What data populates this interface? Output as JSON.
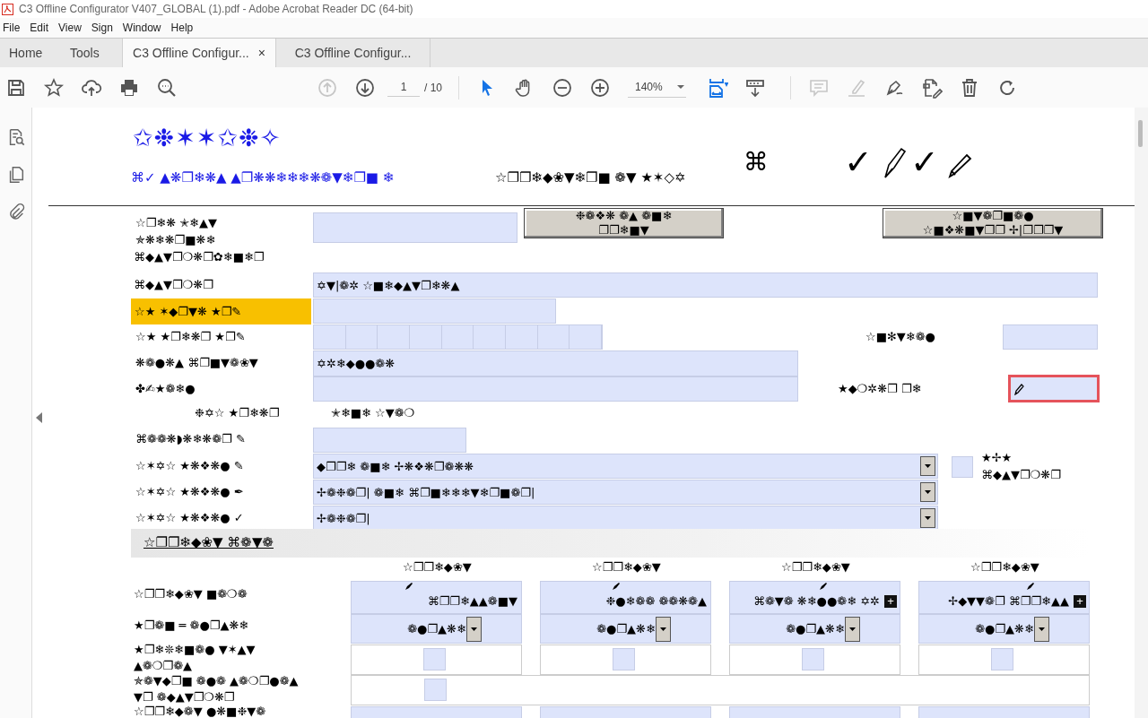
{
  "window": {
    "title": "C3 Offline Configurator V407_GLOBAL (1).pdf - Adobe Acrobat Reader DC (64-bit)"
  },
  "menu": [
    "File",
    "Edit",
    "View",
    "Sign",
    "Window",
    "Help"
  ],
  "tabs": [
    {
      "label": "Home",
      "selected": false
    },
    {
      "label": "Tools",
      "selected": false
    },
    {
      "label": "C3 Offline Configur...",
      "selected": true,
      "close": "×"
    },
    {
      "label": "C3 Offline Configur...",
      "selected": false
    }
  ],
  "toolbar": {
    "page": "1",
    "page_total": "/ 10",
    "zoom": "140%",
    "tools": [
      {
        "kind": "save",
        "disabled": false,
        "selected": false
      },
      {
        "kind": "star",
        "disabled": false,
        "selected": false
      },
      {
        "kind": "upload",
        "disabled": false,
        "selected": false
      },
      {
        "kind": "print",
        "disabled": false,
        "selected": false
      },
      {
        "kind": "search",
        "disabled": false,
        "selected": false
      },
      {
        "kind": "prev",
        "disabled": true,
        "selected": false
      },
      {
        "kind": "next",
        "disabled": false,
        "selected": false
      },
      {
        "kind": "select",
        "disabled": false,
        "selected": true
      },
      {
        "kind": "hand",
        "disabled": false,
        "selected": false
      },
      {
        "kind": "zoomout",
        "disabled": false,
        "selected": false
      },
      {
        "kind": "zoomin",
        "disabled": false,
        "selected": false
      },
      {
        "kind": "fit",
        "disabled": false,
        "selected": true
      },
      {
        "kind": "scroll",
        "disabled": false,
        "selected": false
      },
      {
        "kind": "comment",
        "disabled": true,
        "selected": false
      },
      {
        "kind": "highlight",
        "disabled": true,
        "selected": false
      },
      {
        "kind": "sign",
        "disabled": false,
        "selected": false
      },
      {
        "kind": "edit",
        "disabled": false,
        "selected": false
      },
      {
        "kind": "delete",
        "disabled": false,
        "selected": false
      },
      {
        "kind": "rotate",
        "disabled": false,
        "selected": false
      }
    ]
  },
  "document": {
    "heading": "✩❉✶✶✩❉✧",
    "subheading": "⌘✓ ▲❋❐❄❋▲ ▲❐❋❋❄❄❄❋❁▼❄❐■ ❄",
    "caption": "☆❐❐❄◆❀▼❄❐■ ❁▼ ★✶◇✡",
    "symbol": "⌘",
    "marks": [
      "✓",
      "✓"
    ],
    "form": [
      {
        "kind": "label",
        "text": "☆❐❄❋ ✭❄▲▼",
        "highlighted": false
      },
      {
        "kind": "label",
        "text": "✯❋❄❋❐■❋❄",
        "highlighted": false
      },
      {
        "kind": "label",
        "text": "⌘◆▲▼❐❍❋❐✿❄■❄❐",
        "highlighted": false
      },
      {
        "kind": "text",
        "focused": false
      },
      {
        "kind": "button",
        "lines": [
          "❉❁❖❋ ❁▲ ❁■❄",
          "❐❐❄■▼"
        ]
      },
      {
        "kind": "button",
        "lines": [
          "☆■▼❁❐■❁●",
          "☆■❖❋■▼❐❐ ✢|❐❐❐▼"
        ]
      },
      {
        "kind": "label",
        "text": "⌘◆▲▼❐❍❋❐",
        "highlighted": false
      },
      {
        "kind": "text",
        "value": "✡▼|❁✲ ☆■❄◆▲▼❐❄❋▲",
        "focused": false
      },
      {
        "kind": "label",
        "text": "☆★ ✶◆❐▼❋ ★❐✎",
        "highlighted": true
      },
      {
        "kind": "text",
        "focused": false
      },
      {
        "kind": "label",
        "text": "☆★ ★❐❄❋❐ ★❐✎",
        "highlighted": false
      },
      {
        "kind": "comb"
      },
      {
        "kind": "label",
        "text": "☆■✻▼❄❁●",
        "highlighted": false
      },
      {
        "kind": "text",
        "focused": false
      },
      {
        "kind": "label",
        "text": "❋❁●❋▲ ⌘❐■▼❁❀▼",
        "highlighted": false
      },
      {
        "kind": "text",
        "value": "✡✲❄◆●●❁❋",
        "focused": false
      },
      {
        "kind": "label",
        "text": "✤✍★❁❄●",
        "highlighted": false
      },
      {
        "kind": "text",
        "focused": false
      },
      {
        "kind": "label",
        "text": "★◆❍✲❋❐ ❐❄",
        "highlighted": false
      },
      {
        "kind": "text",
        "focused": true
      },
      {
        "kind": "label",
        "text": "❉✡☆ ★❐❄❋❐",
        "highlighted": false
      },
      {
        "kind": "label",
        "text": "✭❄■❄ ☆▼❁❍",
        "highlighted": false
      },
      {
        "kind": "label",
        "text": "⌘❁❁❋◗❋❄❋❁❐ ✎",
        "highlighted": false
      },
      {
        "kind": "text",
        "focused": false
      },
      {
        "kind": "label",
        "text": "☆✶✡☆ ★❋❖❋● ✎",
        "highlighted": false
      },
      {
        "kind": "dropdown",
        "value": "◆❐❐❄ ❁■❄ ✢❋❖❋❐❁❋❋"
      },
      {
        "kind": "label",
        "text": "☆✶✡☆ ★❋❖❋● ✒",
        "highlighted": false
      },
      {
        "kind": "dropdown",
        "value": "✢❁❉❁❐| ❁■❄ ⌘❐■❄❄❄▼❄❐■❁❐|"
      },
      {
        "kind": "label",
        "text": "☆✶✡☆ ★❋❖❋● ✓",
        "highlighted": false
      },
      {
        "kind": "dropdown",
        "value": "✢❁❉❁❐|"
      },
      {
        "kind": "checkbox",
        "checked": false
      },
      {
        "kind": "label",
        "text": "★✢★",
        "highlighted": false
      },
      {
        "kind": "label",
        "text": "⌘◆▲▼❐❍❋❐",
        "highlighted": false
      }
    ],
    "section": "☆❐❐❄◆❀▼ ⌘❁▼❁",
    "row_labels": [
      "☆❐❐❄◆❀▼ ■❁❍❁",
      "★❐❁■ ═ ❁●❐▲❋❄",
      "★❐❄❊❄■❁● ▼✶▲▼",
      "▲❁❍❐❁▲",
      "✯❁▼◆❐■ ❁●❁ ▲❁❍❐●❁▲",
      "▼❐ ❁◆▲▼❐❍❋❐",
      "☆❐❐❄◆❁▼ ●❋■❉▼❁"
    ],
    "products": [
      {
        "header": "☆❐❐❄◆❀▼",
        "name": "⌘❐❐❄▲▲❁■▼",
        "option": "❁●❐▲❋❄",
        "checked": false
      },
      {
        "header": "☆❐❐❄◆❀▼",
        "name": "❉●❄❁❁ ❁❁❋❁▲",
        "option": "❁●❐▲❋❄",
        "checked": false
      },
      {
        "header": "☆❐❐❄◆❀▼",
        "name": "⌘❁▼❁ ❋❄●●❁❄ ✡✲",
        "option": "❁●❐▲❋❄",
        "checked": false,
        "badge": "+"
      },
      {
        "header": "☆❐❐❄◆❀▼",
        "name": "✢◆▼▼❁❐ ⌘❐❐❄▲▲",
        "option": "❁●❐▲❋❄",
        "checked": false,
        "badge": "+"
      }
    ],
    "shared_checkbox": {
      "checked": false
    }
  }
}
